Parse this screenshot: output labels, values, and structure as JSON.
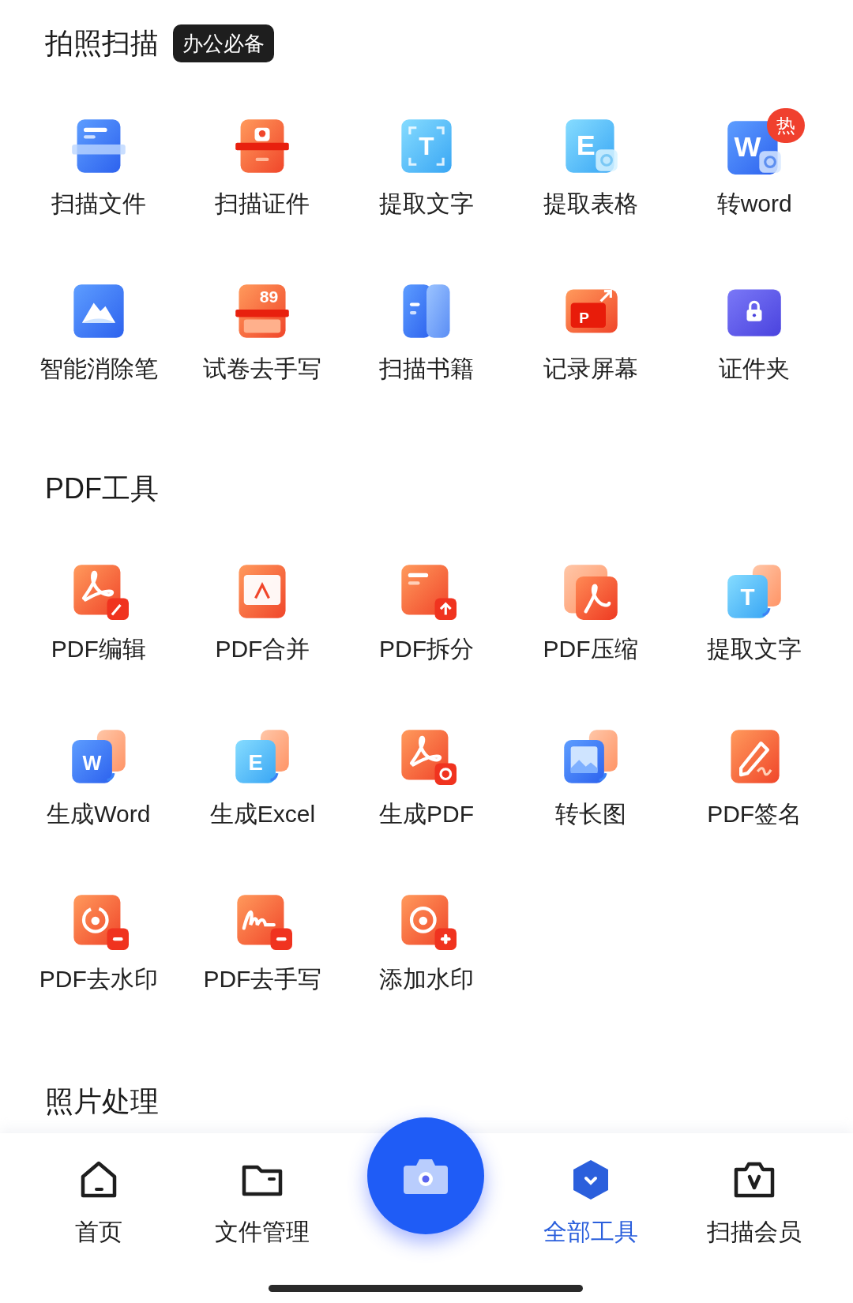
{
  "sections": [
    {
      "title": "拍照扫描",
      "badge": "办公必备",
      "tools": [
        {
          "label": "扫描文件"
        },
        {
          "label": "扫描证件"
        },
        {
          "label": "提取文字",
          "icon_text": "T"
        },
        {
          "label": "提取表格",
          "icon_text": "E"
        },
        {
          "label": "转word",
          "icon_text": "W",
          "badge": "热"
        },
        {
          "label": "智能消除笔"
        },
        {
          "label": "试卷去手写",
          "icon_text": "89"
        },
        {
          "label": "扫描书籍"
        },
        {
          "label": "记录屏幕",
          "icon_text": "P"
        },
        {
          "label": "证件夹"
        }
      ]
    },
    {
      "title": "PDF工具",
      "tools": [
        {
          "label": "PDF编辑"
        },
        {
          "label": "PDF合并"
        },
        {
          "label": "PDF拆分"
        },
        {
          "label": "PDF压缩"
        },
        {
          "label": "提取文字",
          "icon_text": "T"
        },
        {
          "label": "生成Word",
          "icon_text": "W"
        },
        {
          "label": "生成Excel",
          "icon_text": "E"
        },
        {
          "label": "生成PDF"
        },
        {
          "label": "转长图"
        },
        {
          "label": "PDF签名"
        },
        {
          "label": "PDF去水印"
        },
        {
          "label": "PDF去手写"
        },
        {
          "label": "添加水印"
        }
      ]
    },
    {
      "title": "照片处理"
    }
  ],
  "bottom_nav": [
    {
      "label": "首页",
      "selected": false
    },
    {
      "label": "文件管理",
      "selected": false
    },
    {
      "label": "全部工具",
      "selected": true
    },
    {
      "label": "扫描会员",
      "selected": false
    }
  ]
}
